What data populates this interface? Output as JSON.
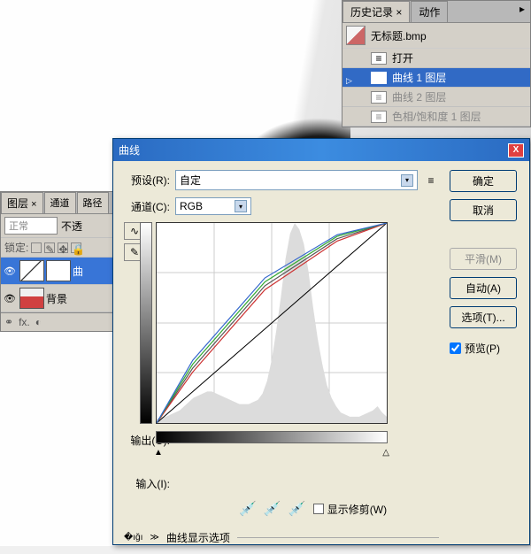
{
  "history": {
    "tabs": {
      "history": "历史记录",
      "actions": "动作"
    },
    "title_file": "无标题.bmp",
    "items": [
      {
        "label": "打开",
        "state": "normal"
      },
      {
        "label": "曲线 1 图层",
        "state": "selected"
      },
      {
        "label": "曲线 2 图层",
        "state": "dim"
      },
      {
        "label": "色相/饱和度 1 图层",
        "state": "dim"
      }
    ]
  },
  "layers": {
    "tabs": {
      "layers": "图层",
      "channels": "通道",
      "paths": "路径"
    },
    "blend_mode": "正常",
    "opacity_label": "不透",
    "lock_label": "锁定:",
    "rows": [
      {
        "name": "曲",
        "kind": "curves",
        "selected": true
      },
      {
        "name": "背景",
        "kind": "photo",
        "selected": false
      }
    ],
    "footer_fx": "fx."
  },
  "curves": {
    "title": "曲线",
    "preset_label": "预设(R):",
    "preset_value": "自定",
    "channel_label": "通道(C):",
    "channel_value": "RGB",
    "output_label": "输出(O):",
    "input_label": "输入(I):",
    "show_clip": "显示修剪(W)",
    "expand_label": "曲线显示选项",
    "buttons": {
      "ok": "确定",
      "cancel": "取消",
      "smooth": "平滑(M)",
      "auto": "自动(A)",
      "options": "选项(T)...",
      "preview": "预览(P)"
    }
  },
  "chart_data": {
    "type": "line",
    "title": "曲线",
    "xlabel": "输入",
    "ylabel": "输出",
    "xlim": [
      0,
      255
    ],
    "ylim": [
      0,
      255
    ],
    "series": [
      {
        "name": "baseline",
        "color": "#000000",
        "x": [
          0,
          255
        ],
        "y": [
          0,
          255
        ]
      },
      {
        "name": "RGB",
        "color": "#555555",
        "x": [
          0,
          40,
          120,
          200,
          255
        ],
        "y": [
          0,
          70,
          175,
          235,
          255
        ]
      },
      {
        "name": "Red",
        "color": "#cc3333",
        "x": [
          0,
          40,
          120,
          200,
          255
        ],
        "y": [
          0,
          65,
          170,
          232,
          255
        ]
      },
      {
        "name": "Green",
        "color": "#33aa33",
        "x": [
          0,
          40,
          120,
          200,
          255
        ],
        "y": [
          0,
          75,
          180,
          238,
          255
        ]
      },
      {
        "name": "Blue",
        "color": "#3366cc",
        "x": [
          0,
          40,
          120,
          200,
          255
        ],
        "y": [
          0,
          80,
          185,
          240,
          255
        ]
      }
    ],
    "histogram": [
      2,
      3,
      3,
      4,
      5,
      6,
      8,
      10,
      12,
      13,
      14,
      15,
      15,
      14,
      13,
      12,
      11,
      10,
      9,
      9,
      9,
      10,
      11,
      14,
      20,
      30,
      44,
      60,
      78,
      90,
      95,
      92,
      85,
      72,
      55,
      40,
      28,
      18,
      12,
      8,
      5,
      4,
      3,
      3,
      3,
      4,
      5,
      6,
      8,
      5,
      3
    ]
  }
}
